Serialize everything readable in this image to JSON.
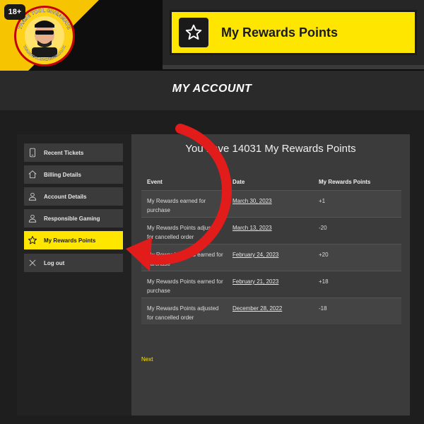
{
  "age_badge": "18+",
  "logo": {
    "ring_text_top": "TRADE TOOL GIVEAWAYS",
    "ring_text_bottom": "TRADETOOLGIVEAWAYS.CO.UK"
  },
  "banner": {
    "label": "My Rewards Points",
    "icon": "star-icon"
  },
  "header": {
    "title": "MY ACCOUNT"
  },
  "sidebar": {
    "items": [
      {
        "label": "Recent Tickets",
        "icon": "phone-icon"
      },
      {
        "label": "Billing Details",
        "icon": "home-icon"
      },
      {
        "label": "Account Details",
        "icon": "user-icon"
      },
      {
        "label": "Responsible Gaming",
        "icon": "user-icon"
      },
      {
        "label": "My Rewards Points",
        "icon": "star-icon",
        "active": true
      },
      {
        "label": "Log out",
        "icon": "close-icon"
      }
    ]
  },
  "main": {
    "headline": "You have 14031 My Rewards Points",
    "table": {
      "columns": [
        "Event",
        "Date",
        "My Rewards Points"
      ],
      "rows": [
        {
          "event": "My Rewards earned for purchase",
          "date": "March 30, 2023",
          "points": "+1"
        },
        {
          "event": "My Rewards Points adjusted for cancelled order",
          "date": "March 13, 2023",
          "points": "-20"
        },
        {
          "event": "My Rewards Points earned for purchase",
          "date": "February 24, 2023",
          "points": "+20"
        },
        {
          "event": "My Rewards Points earned for purchase",
          "date": "February 21, 2023",
          "points": "+18"
        },
        {
          "event": "My Rewards Points adjusted for cancelled order",
          "date": "December 28, 2022",
          "points": "-18"
        }
      ]
    },
    "next_label": "Next"
  },
  "colors": {
    "accent": "#ffe600",
    "arrow": "#e21b1b",
    "panel": "#3b3b3b"
  }
}
